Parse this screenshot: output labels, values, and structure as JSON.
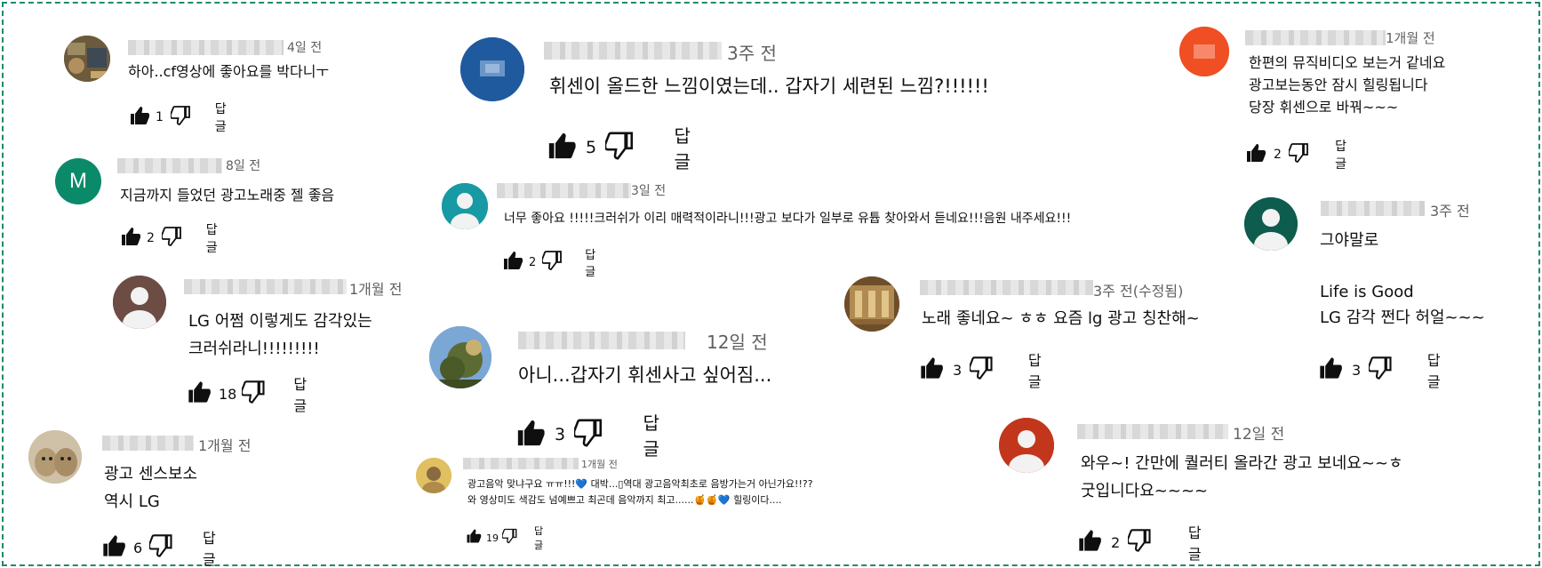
{
  "reply_label": "답글",
  "colors": {
    "border": "#1e8a6e",
    "blue_avatar": "#1f5a9e",
    "red_avatar": "#f04e23",
    "green_avatar": "#0b8a6a",
    "teal_avatar": "#179aa3",
    "brown_avatar": "#6d4c43",
    "dark_teal_avatar": "#0d5c4e",
    "rust_avatar": "#c2361c"
  },
  "comments": [
    {
      "time": "4일 전",
      "lines": [
        "하아..cf영상에 좋아요를 박다니ㅜ"
      ],
      "likes": "1",
      "avatar": "photo-icon"
    },
    {
      "time": "8일 전",
      "lines": [
        "지금까지 들었던 광고노래중 젤 좋음"
      ],
      "likes": "2",
      "avatar_letter": "M"
    },
    {
      "time": "1개월 전",
      "lines": [
        "LG 어쩜 이렇게도 감각있는",
        "크러쉬라니!!!!!!!!!"
      ],
      "likes": "18",
      "avatar": "default-user-icon"
    },
    {
      "time": "1개월 전",
      "lines": [
        "광고 센스보소",
        "역시 LG"
      ],
      "likes": "6",
      "avatar": "photo-icon"
    },
    {
      "time": "3주 전",
      "lines": [
        "휘센이 올드한 느낌이였는데.. 갑자기 세련된 느낌?!!!!!!"
      ],
      "likes": "5",
      "avatar": "blurred-icon"
    },
    {
      "time": "3일 전",
      "lines": [
        "너무 좋아요 !!!!!크러쉬가 이리 매력적이라니!!!광고 보다가 일부로 유튭 찾아와서 듣네요!!!음원 내주세요!!!"
      ],
      "likes": "2",
      "avatar": "default-user-icon"
    },
    {
      "time": "12일 전",
      "lines": [
        "아니...갑자기 휘센사고 싶어짐..."
      ],
      "likes": "3",
      "avatar": "photo-icon"
    },
    {
      "time": "1개월 전",
      "lines": [
        "광고음악 맞냐구요 ㅠㅠ!!!💙 대박...▯역대 광고음악최초로 음방가는거 아닌가요!!??",
        "와 영상미도 색감도 넘예쁘고 최곤데 음악까지 최고......🍯🍯💙 힐링이다...."
      ],
      "likes": "19",
      "avatar": "photo-icon"
    },
    {
      "time": "1개월 전",
      "lines": [
        "한편의 뮤직비디오 보는거 같네요",
        "광고보는동안 잠시 힐링됩니다",
        "당장 휘센으로 바꿔~~~"
      ],
      "likes": "2",
      "avatar": "blurred-icon"
    },
    {
      "time": "3주 전",
      "lines": [
        "그야말로",
        "",
        "Life is Good",
        "LG 감각 쩐다 허얼~~~"
      ],
      "likes": "3",
      "avatar": "default-user-icon"
    },
    {
      "time": "3주 전(수정됨)",
      "lines": [
        "노래 좋네요~ ㅎㅎ 요즘 lg 광고 칭찬해~"
      ],
      "likes": "3",
      "avatar": "photo-icon"
    },
    {
      "time": "12일 전",
      "lines": [
        "와우~! 간만에 퀄러티 올라간 광고 보네요~~ㅎ",
        "굿입니다요~~~~"
      ],
      "likes": "2",
      "avatar": "default-user-icon"
    }
  ]
}
